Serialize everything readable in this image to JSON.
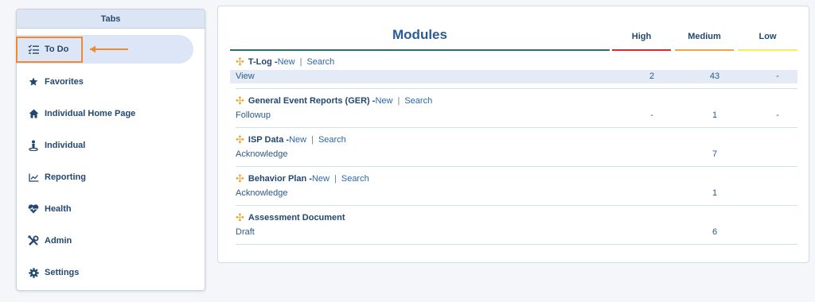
{
  "sidebar": {
    "title": "Tabs",
    "items": [
      {
        "label": "To Do",
        "icon": "checklist-icon"
      },
      {
        "label": "Favorites",
        "icon": "star-icon"
      },
      {
        "label": "Individual Home Page",
        "icon": "home-icon"
      },
      {
        "label": "Individual",
        "icon": "person-icon"
      },
      {
        "label": "Reporting",
        "icon": "line-chart-icon"
      },
      {
        "label": "Health",
        "icon": "heartbeat-icon"
      },
      {
        "label": "Admin",
        "icon": "tools-icon"
      },
      {
        "label": "Settings",
        "icon": "gear-icon"
      }
    ],
    "active_index": 0
  },
  "main": {
    "title": "Modules",
    "columns": [
      {
        "label": "High",
        "color": "#e2262b"
      },
      {
        "label": "Medium",
        "color": "#f0a347"
      },
      {
        "label": "Low",
        "color": "#f3ee5a"
      }
    ],
    "modules": [
      {
        "name": "T-Log - ",
        "new_label": "New",
        "search_label": "Search",
        "sub": "View",
        "high": "2",
        "medium": "43",
        "low": "-"
      },
      {
        "name": "General Event Reports (GER) - ",
        "new_label": "New",
        "search_label": "Search",
        "sub": "Followup",
        "high": "-",
        "medium": "1",
        "low": "-"
      },
      {
        "name": "ISP Data - ",
        "new_label": "New",
        "search_label": "Search",
        "sub": "Acknowledge",
        "high": "",
        "medium": "7",
        "low": ""
      },
      {
        "name": "Behavior Plan - ",
        "new_label": "New",
        "search_label": "Search",
        "sub": "Acknowledge",
        "high": "",
        "medium": "1",
        "low": ""
      },
      {
        "name": "Assessment Document",
        "new_label": "",
        "search_label": "",
        "sub": "Draft",
        "high": "",
        "medium": "6",
        "low": ""
      }
    ]
  },
  "colors": {
    "accent": "#2b5c95",
    "highlight": "#f08a31",
    "active_bg": "#dde6f6"
  }
}
